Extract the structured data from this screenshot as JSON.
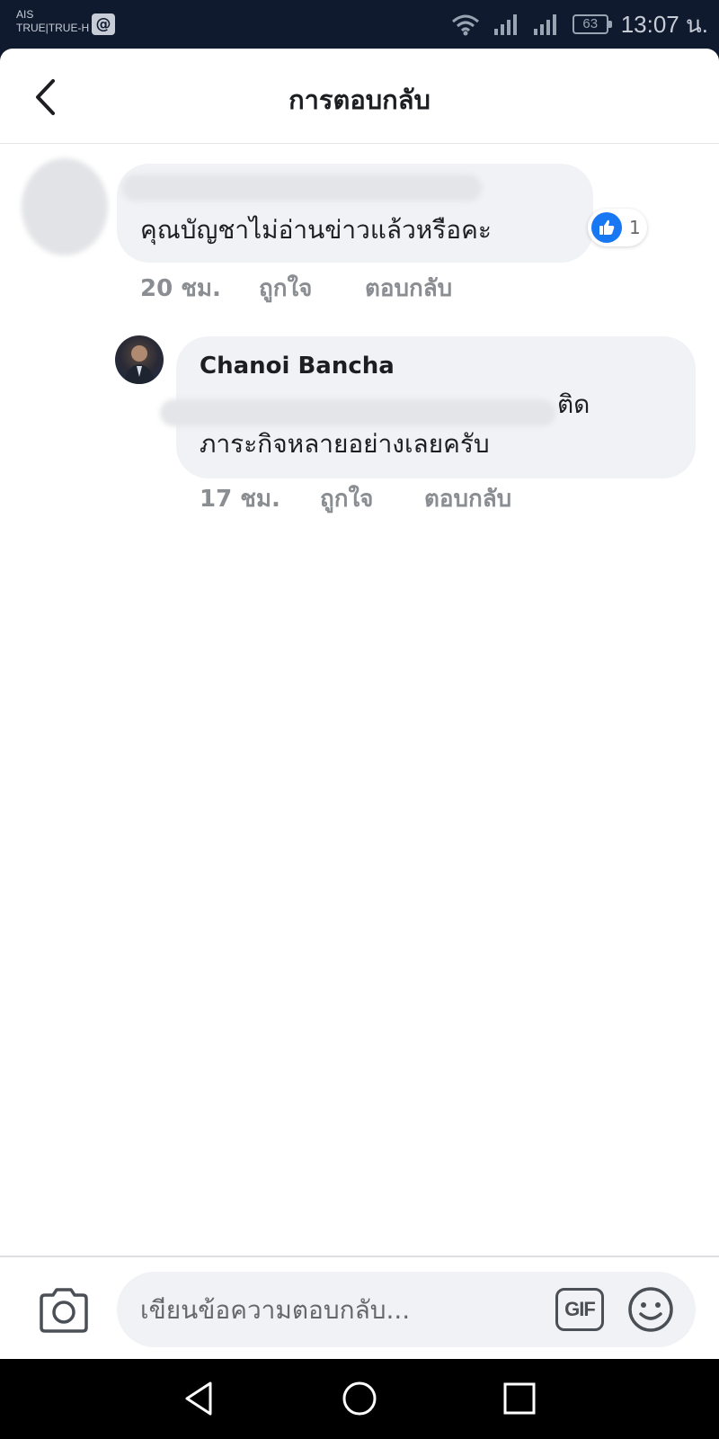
{
  "status_bar": {
    "carrier_line1": "AIS",
    "carrier_line2": "TRUE|TRUE-H",
    "carrier_badge": "@",
    "battery": "63",
    "time": "13:07 น."
  },
  "header": {
    "title": "การตอบกลับ",
    "back_icon": "chevron-left-icon"
  },
  "comments": [
    {
      "author": "",
      "text": "คุณบัญชาไม่อ่านข่าวแล้วหรือคะ",
      "likes": "1",
      "time": "20 ชม.",
      "like_label": "ถูกใจ",
      "reply_label": "ตอบกลับ"
    },
    {
      "author": "Chanoi Bancha",
      "text_line1": "ติด",
      "text_line2": "ภาระกิจหลายอย่างเลยครับ",
      "time": "17 ชม.",
      "like_label": "ถูกใจ",
      "reply_label": "ตอบกลับ"
    }
  ],
  "composer": {
    "placeholder": "เขียนข้อความตอบกลับ...",
    "gif_label": "GIF",
    "camera_icon": "camera-icon",
    "emoji_icon": "smiley-icon"
  },
  "colors": {
    "status_bar_bg": "#0f1a2e",
    "like_blue": "#1877f2",
    "bubble_bg": "#f0f2f5",
    "meta_gray": "#8a8d91"
  }
}
